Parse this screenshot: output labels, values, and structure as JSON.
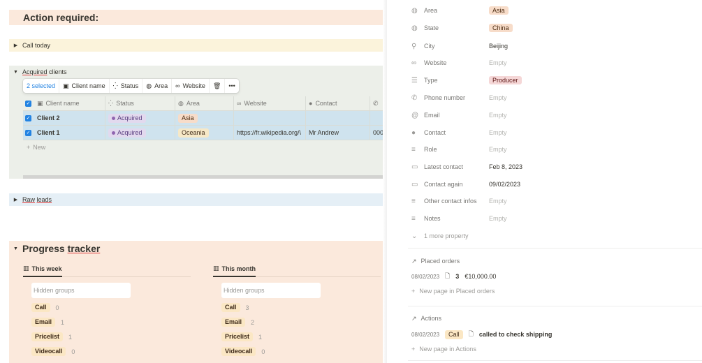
{
  "left": {
    "action_title": "Action required:",
    "call_today": "Call today",
    "acquired": {
      "word1": "Acquired",
      "word2": "clients"
    },
    "toolbar": {
      "selected": "2 selected",
      "client_name": "Client name",
      "status": "Status",
      "area": "Area",
      "website": "Website",
      "more": "•••"
    },
    "table": {
      "headers": {
        "name": "Client name",
        "status": "Status",
        "area": "Area",
        "website": "Website",
        "contact": "Contact"
      },
      "rows": [
        {
          "name": "Client 2",
          "status": "Acquired",
          "area": "Asia",
          "website": "",
          "contact": "",
          "phone": ""
        },
        {
          "name": "Client 1",
          "status": "Acquired",
          "area": "Oceania",
          "website": "https://fr.wikipedia.org/\\",
          "contact": "Mr Andrew",
          "phone": "000"
        }
      ],
      "new_label": "New"
    },
    "raw_leads": {
      "word1": "Raw",
      "word2": "leads"
    },
    "progress": {
      "word1": "Progress",
      "word2": "tracker",
      "boards": [
        {
          "title": "This week",
          "hidden": "Hidden groups",
          "groups": [
            {
              "name": "Call",
              "count": "0"
            },
            {
              "name": "Email",
              "count": "1"
            },
            {
              "name": "Pricelist",
              "count": "1"
            },
            {
              "name": "Videocall",
              "count": "0"
            }
          ]
        },
        {
          "title": "This month",
          "hidden": "Hidden groups",
          "groups": [
            {
              "name": "Call",
              "count": "3"
            },
            {
              "name": "Email",
              "count": "2"
            },
            {
              "name": "Pricelist",
              "count": "1"
            },
            {
              "name": "Videocall",
              "count": "0"
            }
          ]
        }
      ]
    }
  },
  "right": {
    "properties": [
      {
        "label": "Area",
        "value": "Asia",
        "icon": "globe-icon"
      },
      {
        "label": "State",
        "value": "China",
        "icon": "globe-icon"
      },
      {
        "label": "City",
        "value": "Beijing",
        "icon": "pin-icon"
      },
      {
        "label": "Website",
        "value": "Empty",
        "icon": "link-icon"
      },
      {
        "label": "Type",
        "value": "Producer",
        "icon": "list-icon"
      },
      {
        "label": "Phone number",
        "value": "Empty",
        "icon": "phone-icon"
      },
      {
        "label": "Email",
        "value": "Empty",
        "icon": "at-icon"
      },
      {
        "label": "Contact",
        "value": "Empty",
        "icon": "person-icon"
      },
      {
        "label": "Role",
        "value": "Empty",
        "icon": "text-icon"
      },
      {
        "label": "Latest contact",
        "value": "Feb 8, 2023",
        "icon": "calendar-icon"
      },
      {
        "label": "Contact again",
        "value": "09/02/2023",
        "icon": "calendar-icon"
      },
      {
        "label": "Other contact infos",
        "value": "Empty",
        "icon": "text-icon"
      },
      {
        "label": "Notes",
        "value": "Empty",
        "icon": "text-icon"
      }
    ],
    "more_property": "1 more property",
    "placed_orders": {
      "title": "Placed orders",
      "date": "08/02/2023",
      "count": "3",
      "amount": "€10,000.00",
      "new": "New page in Placed orders"
    },
    "actions": {
      "title": "Actions",
      "date": "08/02/2023",
      "tag": "Call",
      "text": "called to check shipping",
      "new": "New page in Actions"
    }
  }
}
